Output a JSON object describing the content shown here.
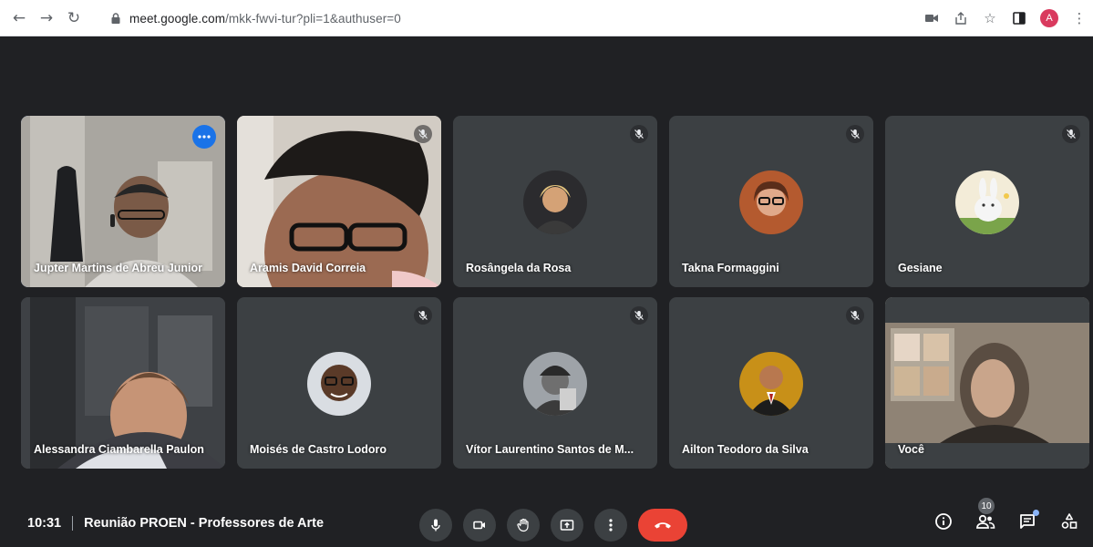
{
  "browser": {
    "url_host": "meet.google.com",
    "url_path": "/mkk-fwvi-tur?pli=1&authuser=0",
    "profile_initial": "A",
    "profile_color": "#d93a5e"
  },
  "tiles": [
    {
      "name": "Jupter Martins de Abreu Junior",
      "muted": false,
      "active": true
    },
    {
      "name": "Aramis David Correia",
      "muted": true,
      "active": false
    },
    {
      "name": "Rosângela da Rosa",
      "muted": true,
      "active": false
    },
    {
      "name": "Takna Formaggini",
      "muted": true,
      "active": false
    },
    {
      "name": "Gesiane",
      "muted": true,
      "active": false
    },
    {
      "name": "Alessandra Ciambarella Paulon",
      "muted": false,
      "active": false
    },
    {
      "name": "Moisés de Castro Lodoro",
      "muted": true,
      "active": false
    },
    {
      "name": "Vítor Laurentino Santos de M...",
      "muted": true,
      "active": false
    },
    {
      "name": "Ailton Teodoro da Silva",
      "muted": true,
      "active": false
    },
    {
      "name": "Você",
      "muted": false,
      "active": false
    }
  ],
  "meeting": {
    "time": "10:31",
    "title": "Reunião PROEN - Professores de Arte"
  },
  "people_count": "10",
  "colors": {
    "background": "#202124",
    "tile": "#3c4043",
    "end_call": "#ea4335",
    "accent": "#8ab4f8"
  },
  "icons": {
    "mic": "mic-icon",
    "camera": "camera-icon",
    "raise_hand": "hand-icon",
    "present": "present-icon",
    "more": "more-vert-icon",
    "end_call": "phone-hangup-icon",
    "info": "info-icon",
    "people": "people-icon",
    "chat": "chat-icon",
    "activities": "activities-icon"
  }
}
